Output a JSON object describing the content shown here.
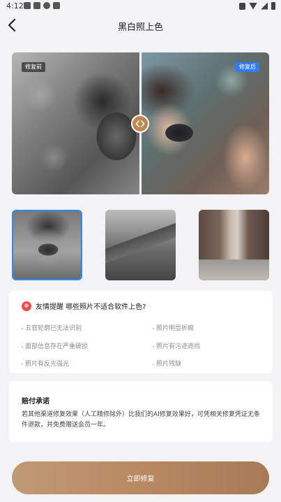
{
  "status_bar": {
    "time": "4:12"
  },
  "nav": {
    "title": "黑白照上色"
  },
  "compare": {
    "before_label": "修复前",
    "after_label": "修复后"
  },
  "thumbnails": [
    {
      "selected": true
    },
    {
      "selected": false
    },
    {
      "selected": false
    }
  ],
  "tips": {
    "title": "友情提醒 哪些照片不适合软件上色?",
    "items": [
      "五官轮廓已无法识别",
      "照片明显折痕",
      "面部信息存在严重破损",
      "照片有污迹遮挡",
      "照片有反光强光",
      "照片残缺"
    ]
  },
  "promise": {
    "title": "赔付承诺",
    "text": "若其他渠道修复效果（人工精修除外）比我们的AI修复效果好，可凭相关修复凭证无条件退款，并免费赠送会员一年。"
  },
  "cta": {
    "label": "立即修复"
  },
  "colors": {
    "accent": "#2f8cf6",
    "cta": "#b88962",
    "handle": "#c0874e"
  }
}
